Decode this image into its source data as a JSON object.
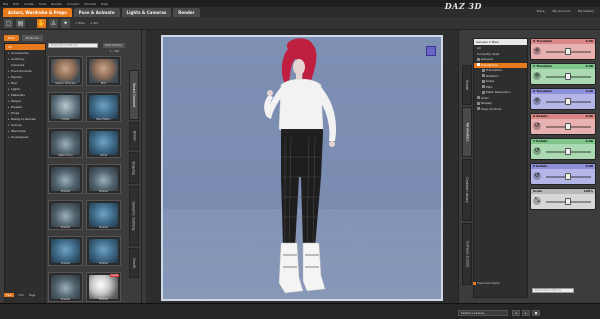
{
  "menubar": [
    "File",
    "Edit",
    "Create",
    "Tools",
    "Render",
    "Connect",
    "Window",
    "Help"
  ],
  "rooms": [
    {
      "label": "Actors, Wardrobe & Props",
      "active": true
    },
    {
      "label": "Pose & Animate",
      "active": false
    },
    {
      "label": "Lights & Cameras",
      "active": false
    },
    {
      "label": "Render",
      "active": false
    }
  ],
  "logo": "DAZ 3D",
  "toplinks": [
    "Store",
    "My Account",
    "My Gallery"
  ],
  "toolbar": {
    "prev": "< Prev",
    "next": "+ Pro"
  },
  "left": {
    "tabs": [
      "Files",
      "Products"
    ],
    "search_placeholder": "Enter text to filter by",
    "menu": "DAZ 3D Store",
    "count": "1 - 110",
    "categories": [
      {
        "label": "All",
        "active": true
      },
      {
        "label": "Accessories",
        "active": false
      },
      {
        "label": "Anatomy",
        "active": false
      },
      {
        "label": "Cameras",
        "active": false
      },
      {
        "label": "Environments",
        "active": false
      },
      {
        "label": "Figures",
        "active": false
      },
      {
        "label": "Hair",
        "active": false
      },
      {
        "label": "Lights",
        "active": false
      },
      {
        "label": "Materials",
        "active": false
      },
      {
        "label": "People",
        "active": false
      },
      {
        "label": "Presets",
        "active": false
      },
      {
        "label": "Props",
        "active": false
      },
      {
        "label": "Ready to Render",
        "active": false
      },
      {
        "label": "Scenes",
        "active": false
      },
      {
        "label": "Wardrobe",
        "active": false
      },
      {
        "label": "Unassigned",
        "active": false
      }
    ],
    "thumbs": [
      {
        "label": "Sophia, Chamber",
        "badge": "",
        "style": "person"
      },
      {
        "label": "Nico",
        "badge": "",
        "style": "person"
      },
      {
        "label": "Cortex",
        "badge": "",
        "style": "pill"
      },
      {
        "label": "Blue Edition",
        "badge": "",
        "style": "char"
      },
      {
        "label": "Glass Armor",
        "badge": "",
        "style": "arch"
      },
      {
        "label": "Ghost",
        "badge": "",
        "style": "char"
      },
      {
        "label": "Preload",
        "badge": "Preload",
        "style": "arch"
      },
      {
        "label": "Preload",
        "badge": "Preload",
        "style": "arch"
      },
      {
        "label": "Preload",
        "badge": "",
        "style": "arch"
      },
      {
        "label": "Preload",
        "badge": "",
        "style": "char"
      },
      {
        "label": "Preload",
        "badge": "",
        "style": "char"
      },
      {
        "label": "Preload",
        "badge": "",
        "style": "char"
      },
      {
        "label": "Preload",
        "badge": "",
        "style": "arch"
      },
      {
        "label": "Preload",
        "badge": "Lights",
        "style": "sphere"
      }
    ],
    "vtabs": [
      "Smart Content",
      "DForm",
      "Shaping",
      "Dynamic Clothing",
      "Geofit"
    ],
    "footer": [
      "Tips",
      "Info",
      "Tags"
    ]
  },
  "right": {
    "vtabs": [
      "Scene",
      "Parameters",
      "Content Library",
      "Surfaces (Color)"
    ],
    "selected_figure": "Genesis 2 Male",
    "tree": [
      {
        "label": "All",
        "active": false,
        "child": false
      },
      {
        "label": "Currently Used",
        "active": false,
        "child": false
      },
      {
        "label": "General",
        "active": false,
        "child": false
      },
      {
        "label": "Transforms",
        "active": true,
        "child": false
      },
      {
        "label": "Translation",
        "active": false,
        "child": true
      },
      {
        "label": "Rotation",
        "active": false,
        "child": true
      },
      {
        "label": "Scale",
        "active": false,
        "child": true
      },
      {
        "label": "Misc",
        "active": false,
        "child": true
      },
      {
        "label": "Mesh Resolution",
        "active": false,
        "child": true
      },
      {
        "label": "Actor",
        "active": false,
        "child": false
      },
      {
        "label": "Display",
        "active": false,
        "child": false
      },
      {
        "label": "Pose Controls",
        "active": false,
        "child": false
      }
    ],
    "show_sub_items": "Show Sub Items",
    "dials": [
      {
        "label": "X Translate",
        "value": "0.00",
        "color": "red",
        "icon": "✢"
      },
      {
        "label": "Y Translate",
        "value": "0.00",
        "color": "green",
        "icon": "✢"
      },
      {
        "label": "Z Translate",
        "value": "0.00",
        "color": "blue",
        "icon": "✢"
      },
      {
        "label": "X Rotate",
        "value": "0.00",
        "color": "red",
        "icon": "↺"
      },
      {
        "label": "Y Rotate",
        "value": "0.00",
        "color": "green",
        "icon": "↺"
      },
      {
        "label": "Z Rotate",
        "value": "0.00",
        "color": "blue",
        "icon": "↺"
      },
      {
        "label": "Scale",
        "value": "100%",
        "color": "gray",
        "icon": "⤡"
      }
    ],
    "search_placeholder": "Enter text to filter by"
  },
  "status": {
    "lesson_select": "Select a Lesson..."
  }
}
